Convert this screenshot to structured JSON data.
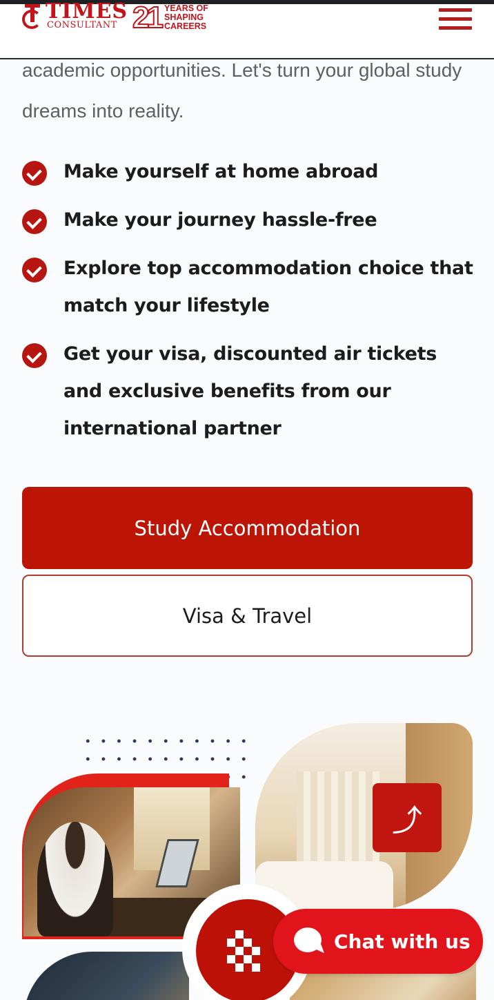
{
  "header": {
    "logo_name": "TIMES",
    "logo_sub": "CONSULTANT",
    "anniversary_number": "21",
    "anniversary_line1": "YEARS OF",
    "anniversary_line2": "SHAPING",
    "anniversary_line3": "CAREERS",
    "menu_icon": "hamburger-menu-icon"
  },
  "intro": {
    "text": "academic opportunities. Let's turn your global study dreams into reality."
  },
  "benefits": [
    "Make yourself at home abroad",
    "Make your journey hassle-free",
    "Explore top accommodation choice that match your lifestyle",
    "Get your visa, discounted air tickets and exclusive benefits from our international partner"
  ],
  "buttons": {
    "primary": "Study Accommodation",
    "secondary": "Visa & Travel"
  },
  "scroll_top": {
    "symbol": "⤴"
  },
  "chat": {
    "label": "Chat with us"
  },
  "colors": {
    "brand_red": "#bc1506",
    "chat_red": "#e0141a",
    "text_dark": "#1c1c1c",
    "text_muted": "#5c5f66"
  }
}
